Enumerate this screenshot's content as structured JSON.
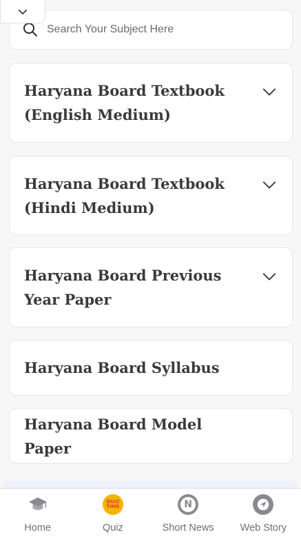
{
  "search": {
    "placeholder": "Search Your Subject Here"
  },
  "subjects": [
    {
      "label": "Haryana Board Textbook (English Medium)",
      "expandable": true
    },
    {
      "label": "Haryana Board Textbook (Hindi Medium)",
      "expandable": true
    },
    {
      "label": "Haryana Board Previous Year Paper",
      "expandable": true
    },
    {
      "label": "Haryana Board Syllabus",
      "expandable": false
    },
    {
      "label": "Haryana Board Model Paper",
      "expandable": false
    }
  ],
  "bottom_nav": {
    "items": [
      {
        "label": "Home",
        "icon": "graduation-cap-icon"
      },
      {
        "label": "Quiz",
        "icon": "quiz-time-icon",
        "badge_text": "QUIZ TIME"
      },
      {
        "label": "Short News",
        "icon": "news-icon",
        "badge_text": "N"
      },
      {
        "label": "Web Story",
        "icon": "web-story-icon"
      }
    ]
  },
  "colors": {
    "background": "#f7f7f8",
    "card": "#ffffff",
    "title_text": "#3a3a3c",
    "nav_text": "#6f6f73",
    "quiz_yellow": "#f4b400",
    "quiz_red": "#e2402b"
  }
}
